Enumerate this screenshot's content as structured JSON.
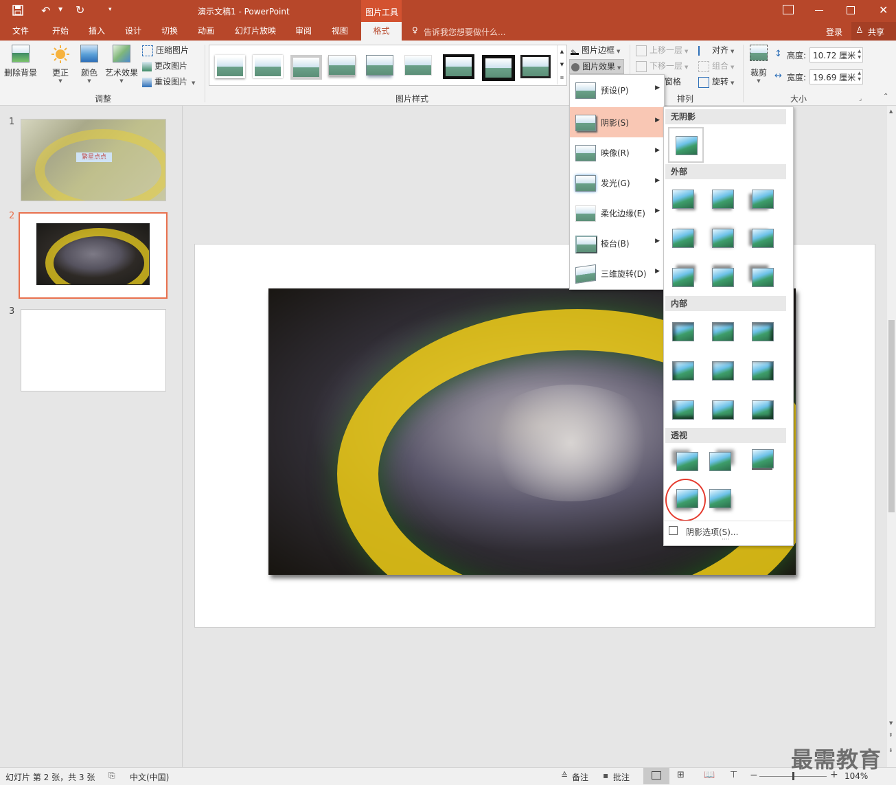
{
  "title_bar": {
    "doc_title": "演示文稿1 - PowerPoint",
    "context_tool": "图片工具"
  },
  "tabs": [
    "文件",
    "开始",
    "插入",
    "设计",
    "切换",
    "动画",
    "幻灯片放映",
    "审阅",
    "视图",
    "格式"
  ],
  "active_tab": "格式",
  "tell_me": "告诉我您想要做什么...",
  "account": {
    "login": "登录",
    "share": "共享"
  },
  "ribbon": {
    "adjust": {
      "remove_bg": "删除背景",
      "corrections": "更正",
      "color": "颜色",
      "artistic": "艺术效果",
      "compress": "压缩图片",
      "change": "更改图片",
      "reset": "重设图片",
      "group_label": "调整"
    },
    "styles": {
      "group_label": "图片样式",
      "border": "图片边框",
      "effects": "图片效果"
    },
    "arrange": {
      "bring_forward": "上移一层",
      "send_backward": "下移一层",
      "selection_pane": "窗格",
      "align": "对齐",
      "group": "组合",
      "rotate": "旋转",
      "group_label": "排列"
    },
    "size": {
      "crop": "裁剪",
      "height_label": "高度:",
      "height_value": "10.72 厘米",
      "width_label": "宽度:",
      "width_value": "19.69 厘米",
      "group_label": "大小"
    }
  },
  "slides": [
    {
      "num": "1"
    },
    {
      "num": "2"
    },
    {
      "num": "3"
    }
  ],
  "slide1_caption": "繁星点点",
  "effects_menu": [
    {
      "label": "预设(P)"
    },
    {
      "label": "阴影(S)"
    },
    {
      "label": "映像(R)"
    },
    {
      "label": "发光(G)"
    },
    {
      "label": "柔化边缘(E)"
    },
    {
      "label": "棱台(B)"
    },
    {
      "label": "三维旋转(D)"
    }
  ],
  "shadow_panel": {
    "no_shadow": "无阴影",
    "outer": "外部",
    "inner": "内部",
    "perspective": "透视",
    "options": "阴影选项(S)..."
  },
  "status": {
    "slide_info": "幻灯片 第 2 张，共 3 张",
    "language": "中文(中国)",
    "notes": "备注",
    "comments": "批注",
    "zoom": "104%"
  },
  "watermark": "最需教育",
  "colors": {
    "accent": "#b7472a",
    "highlight": "#f9c7b4",
    "selected_slide": "#e8704d"
  }
}
